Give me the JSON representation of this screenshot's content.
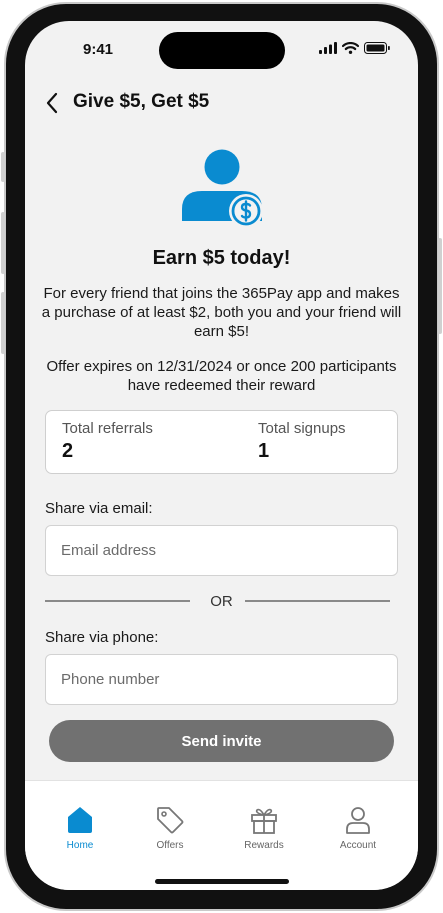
{
  "status_bar": {
    "time": "9:41"
  },
  "header": {
    "title": "Give $5, Get $5"
  },
  "hero": {
    "headline": "Earn $5 today!",
    "description": "For every friend that joins the 365Pay app and makes a purchase of at least $2, both you and your friend will earn $5!",
    "expiry": "Offer expires on 12/31/2024 or once 200 participants have redeemed their reward"
  },
  "stats": {
    "referrals_label": "Total referrals",
    "referrals_value": "2",
    "signups_label": "Total signups",
    "signups_value": "1"
  },
  "share": {
    "email_label": "Share via email:",
    "email_placeholder": "Email address",
    "or_text": "OR",
    "phone_label": "Share via phone:",
    "phone_placeholder": "Phone number",
    "send_label": "Send invite"
  },
  "tabs": [
    {
      "label": "Home",
      "icon": "home-icon",
      "active": true
    },
    {
      "label": "Offers",
      "icon": "tag-icon",
      "active": false
    },
    {
      "label": "Rewards",
      "icon": "gift-icon",
      "active": false
    },
    {
      "label": "Account",
      "icon": "person-icon",
      "active": false
    }
  ],
  "colors": {
    "accent": "#0a8bd0",
    "button_disabled": "#717171",
    "screen_background": "#f2f2f2"
  }
}
